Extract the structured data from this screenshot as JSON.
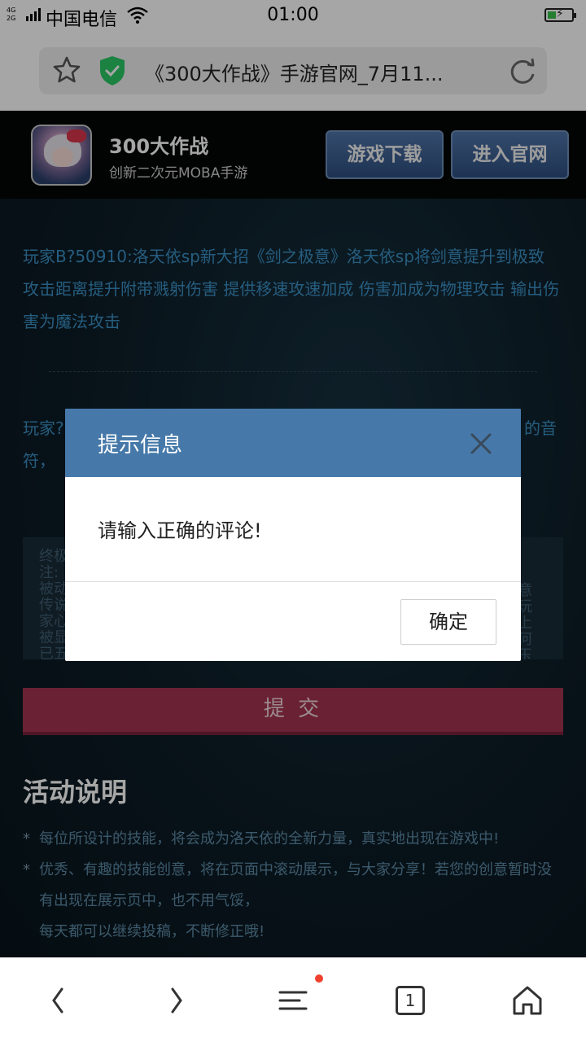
{
  "status_bar": {
    "network_top": "4G",
    "network_bottom": "2G",
    "carrier": "中国电信",
    "time": "01:00"
  },
  "browser": {
    "page_title": "《300大作战》手游官网_7月11..."
  },
  "banner": {
    "app_name": "300大作战",
    "app_subtitle": "创新二次元MOBA手游",
    "download_label": "游戏下载",
    "official_label": "进入官网"
  },
  "comments": [
    {
      "text": "玩家B?50910:洛天依sp新大招《剑之极意》洛天依sp将剑意提升到极致 攻击距离提升附带溅射伤害 提供移速攻速加成 伤害加成为物理攻击 输出伤害为魔法攻击"
    },
    {
      "text_left": "玩家?",
      "text_right": "的音",
      "line2": "符，"
    }
  ],
  "textarea_fragments": {
    "left": [
      "终极",
      "注:",
      "被动",
      "传说",
      "家心",
      "被显",
      "已五"
    ],
    "right": [
      "意",
      "玩",
      "上",
      "何",
      "玉"
    ]
  },
  "submit_label": "提 交",
  "section": {
    "title": "活动说明",
    "rules": [
      "每位所设计的技能，将会成为洛天依的全新力量，真实地出现在游戏中!",
      "优秀、有趣的技能创意，将在页面中滚动展示，与大家分享！若您的创意暂时没有出现在展示页中，也不用气馁，",
      "每天都可以继续投稿，不断修正哦!"
    ]
  },
  "dialog": {
    "title": "提示信息",
    "message": "请输入正确的评论!",
    "ok_label": "确定"
  },
  "bottom_nav": {
    "tab_count": "1"
  },
  "colors": {
    "dialog_header": "#4679a9",
    "submit": "#a4334f",
    "comment_text": "#3b8fc4",
    "badge_dot": "#f0412f"
  }
}
